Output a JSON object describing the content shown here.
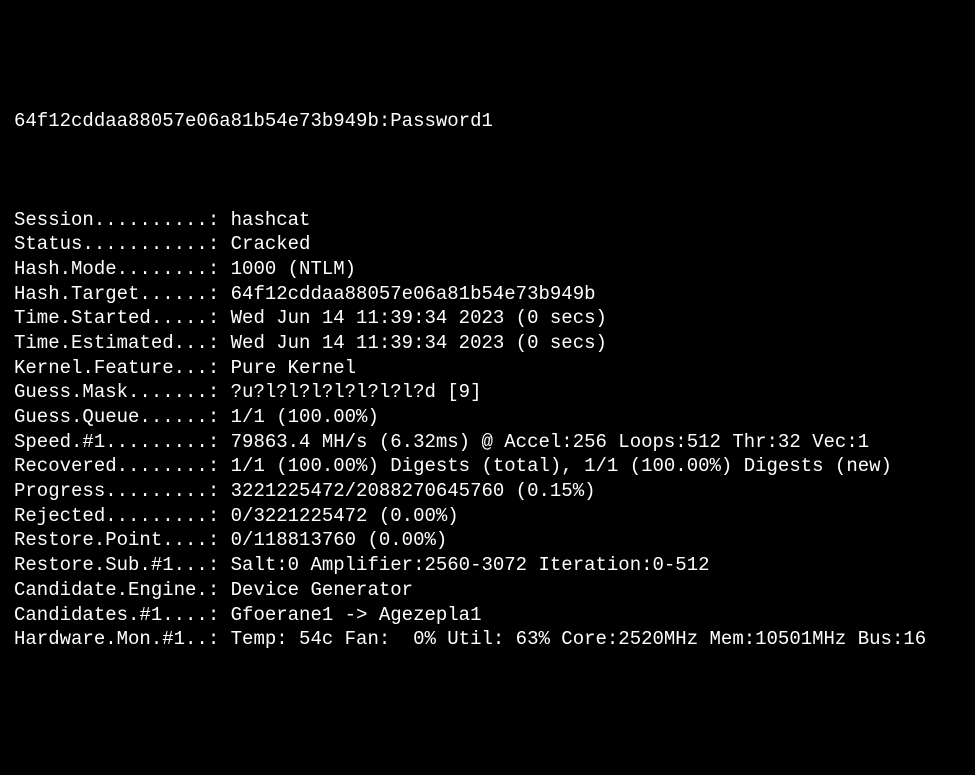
{
  "cracked": {
    "hash": "64f12cddaa88057e06a81b54e73b949b",
    "separator": ":",
    "plaintext": "Password1"
  },
  "status": [
    {
      "label": "Session..........:",
      "value": " hashcat"
    },
    {
      "label": "Status...........:",
      "value": " Cracked"
    },
    {
      "label": "Hash.Mode........:",
      "value": " 1000 (NTLM)"
    },
    {
      "label": "Hash.Target......:",
      "value": " 64f12cddaa88057e06a81b54e73b949b"
    },
    {
      "label": "Time.Started.....:",
      "value": " Wed Jun 14 11:39:34 2023 (0 secs)"
    },
    {
      "label": "Time.Estimated...:",
      "value": " Wed Jun 14 11:39:34 2023 (0 secs)"
    },
    {
      "label": "Kernel.Feature...:",
      "value": " Pure Kernel"
    },
    {
      "label": "Guess.Mask.......:",
      "value": " ?u?l?l?l?l?l?l?l?d [9]"
    },
    {
      "label": "Guess.Queue......:",
      "value": " 1/1 (100.00%)"
    },
    {
      "label": "Speed.#1.........:",
      "value": " 79863.4 MH/s (6.32ms) @ Accel:256 Loops:512 Thr:32 Vec:1"
    },
    {
      "label": "Recovered........:",
      "value": " 1/1 (100.00%) Digests (total), 1/1 (100.00%) Digests (new)"
    },
    {
      "label": "Progress.........:",
      "value": " 3221225472/2088270645760 (0.15%)"
    },
    {
      "label": "Rejected.........:",
      "value": " 0/3221225472 (0.00%)"
    },
    {
      "label": "Restore.Point....:",
      "value": " 0/118813760 (0.00%)"
    },
    {
      "label": "Restore.Sub.#1...:",
      "value": " Salt:0 Amplifier:2560-3072 Iteration:0-512"
    },
    {
      "label": "Candidate.Engine.:",
      "value": " Device Generator"
    },
    {
      "label": "Candidates.#1....:",
      "value": " Gfoerane1 -> Agezepla1"
    },
    {
      "label": "Hardware.Mon.#1..:",
      "value": " Temp: 54c Fan:  0% Util: 63% Core:2520MHz Mem:10501MHz Bus:16"
    }
  ]
}
